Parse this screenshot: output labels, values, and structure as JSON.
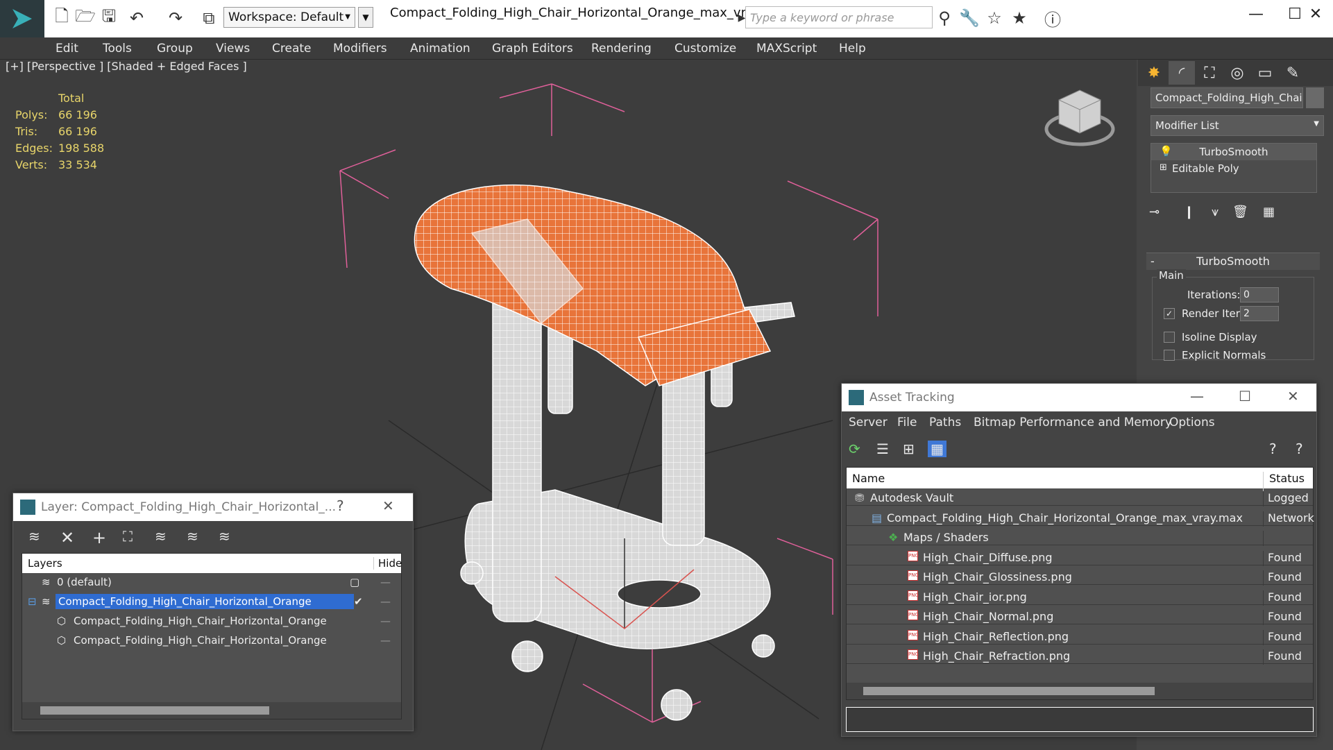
{
  "titlebar": {
    "workspace": "Workspace: Default",
    "document_title": "Compact_Folding_High_Chair_Horizontal_Orange_max_vray...",
    "search_placeholder": "Type a keyword or phrase"
  },
  "menu": [
    "Edit",
    "Tools",
    "Group",
    "Views",
    "Create",
    "Modifiers",
    "Animation",
    "Graph Editors",
    "Rendering",
    "Customize",
    "MAXScript",
    "Help"
  ],
  "viewport": {
    "label": "[+] [Perspective ] [Shaded + Edged Faces ]",
    "stats": {
      "header": "Total",
      "rows": [
        {
          "k": "Polys:",
          "v": "66 196"
        },
        {
          "k": "Tris:",
          "v": "66 196"
        },
        {
          "k": "Edges:",
          "v": "198 588"
        },
        {
          "k": "Verts:",
          "v": "33 534"
        }
      ]
    },
    "colors": {
      "mesh_orange": "#e8743a",
      "wire": "#ffffff",
      "bbox": "#e0609a",
      "background": "#3d3d3d"
    }
  },
  "command_panel": {
    "object_name": "Compact_Folding_High_Chair_H",
    "modifier_list": "Modifier List",
    "stack": [
      "TurboSmooth",
      "Editable Poly"
    ],
    "rollout_title": "TurboSmooth",
    "group_main": "Main",
    "iterations_label": "Iterations:",
    "iterations_value": "0",
    "render_iters_label": "Render Iters:",
    "render_iters_value": "2",
    "isoline_label": "Isoline Display",
    "explicit_normals_label": "Explicit Normals"
  },
  "layer_dialog": {
    "title": "Layer: Compact_Folding_High_Chair_Horizontal_...",
    "help": "?",
    "col_layers": "Layers",
    "col_hide": "Hide",
    "rows": [
      {
        "name": "0 (default)"
      },
      {
        "name": "Compact_Folding_High_Chair_Horizontal_Orange"
      },
      {
        "name": "Compact_Folding_High_Chair_Horizontal_Orange"
      },
      {
        "name": "Compact_Folding_High_Chair_Horizontal_Orange"
      }
    ]
  },
  "asset_dialog": {
    "title": "Asset Tracking",
    "menu": [
      "Server",
      "File",
      "Paths",
      "Bitmap Performance and Memory",
      "Options"
    ],
    "col_name": "Name",
    "col_status": "Status",
    "rows": [
      {
        "name": "Autodesk Vault",
        "status": "Logged"
      },
      {
        "name": "Compact_Folding_High_Chair_Horizontal_Orange_max_vray.max",
        "status": "Network"
      },
      {
        "name": "Maps / Shaders",
        "status": ""
      },
      {
        "name": "High_Chair_Diffuse.png",
        "status": "Found"
      },
      {
        "name": "High_Chair_Glossiness.png",
        "status": "Found"
      },
      {
        "name": "High_Chair_ior.png",
        "status": "Found"
      },
      {
        "name": "High_Chair_Normal.png",
        "status": "Found"
      },
      {
        "name": "High_Chair_Reflection.png",
        "status": "Found"
      },
      {
        "name": "High_Chair_Refraction.png",
        "status": "Found"
      }
    ]
  }
}
